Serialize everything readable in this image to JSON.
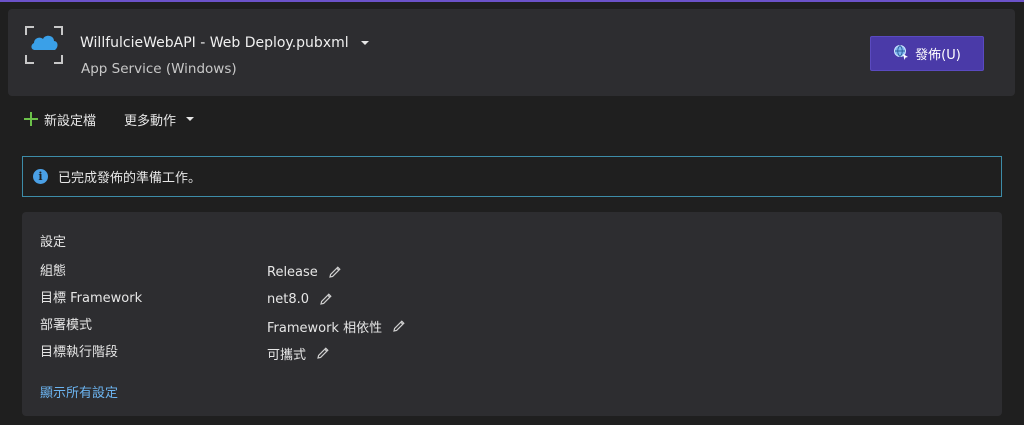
{
  "header": {
    "profile_name": "WillfulcieWebAPI - Web Deploy.pubxml",
    "profile_subtitle": "App Service (Windows)",
    "publish_label": "發佈(U)",
    "accent_color": "#4a3aa8"
  },
  "toolbar": {
    "new_profile_label": "新設定檔",
    "more_actions_label": "更多動作"
  },
  "info": {
    "message": "已完成發佈的準備工作。"
  },
  "settings": {
    "title": "設定",
    "rows": [
      {
        "key": "組態",
        "value": "Release"
      },
      {
        "key": "目標 Framework",
        "value": "net8.0"
      },
      {
        "key": "部署模式",
        "value": "Framework 相依性"
      },
      {
        "key": "目標執行階段",
        "value": "可攜式"
      }
    ],
    "show_all_label": "顯示所有設定"
  },
  "icons": {
    "profile": "cloud-app-service-icon",
    "publish": "publish-globe-icon",
    "new": "plus-icon",
    "info": "info-icon",
    "edit": "pencil-icon"
  }
}
